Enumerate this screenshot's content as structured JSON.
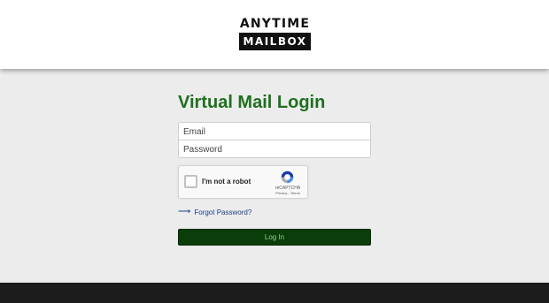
{
  "header": {
    "logo_top": "ANYTIME",
    "logo_bottom": "MAILBOX"
  },
  "login": {
    "title": "Virtual Mail Login",
    "email_placeholder": "Email",
    "password_placeholder": "Password",
    "forgot_label": "Forgot Password?",
    "forgot_icon": "arrow-right-icon",
    "button_label": "Log In"
  },
  "captcha": {
    "checkbox_label": "I'm not a robot",
    "brand": "reCAPTCHA",
    "links": "Privacy - Terms",
    "icon": "recaptcha-logo-icon"
  },
  "colors": {
    "title_green": "#1f6f1f",
    "button_bg": "#0b3d0b",
    "button_text": "#8fd18f",
    "link_blue": "#1a3e8a",
    "footer_bg": "#1c1c1c",
    "page_bg": "#ececec"
  }
}
